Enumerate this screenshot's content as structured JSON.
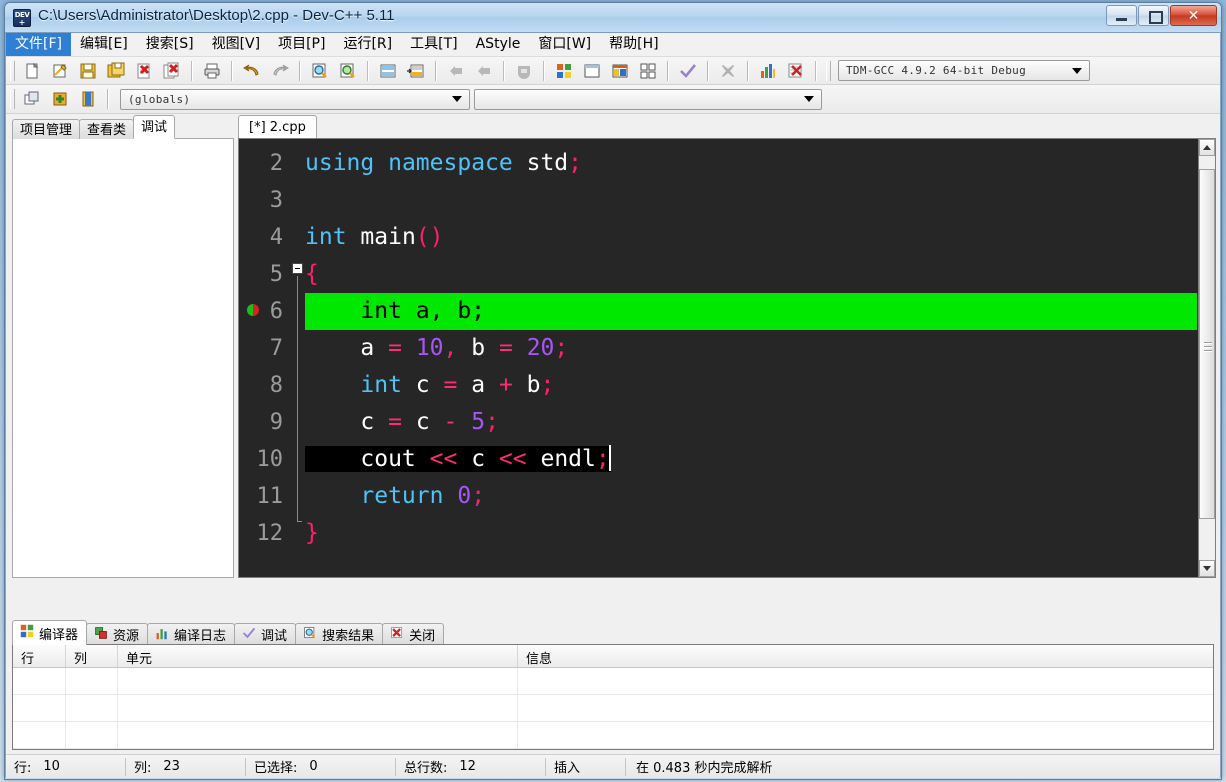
{
  "window": {
    "title": "C:\\Users\\Administrator\\Desktop\\2.cpp - Dev-C++ 5.11",
    "icon": "devcpp-icon",
    "minimize": "minimize-button",
    "maximize": "maximize-button",
    "close": "close-button"
  },
  "menu": [
    {
      "label": "文件[F]",
      "active": true
    },
    {
      "label": "编辑[E]",
      "active": false
    },
    {
      "label": "搜索[S]",
      "active": false
    },
    {
      "label": "视图[V]",
      "active": false
    },
    {
      "label": "项目[P]",
      "active": false
    },
    {
      "label": "运行[R]",
      "active": false
    },
    {
      "label": "工具[T]",
      "active": false
    },
    {
      "label": "AStyle",
      "active": false
    },
    {
      "label": "窗口[W]",
      "active": false
    },
    {
      "label": "帮助[H]",
      "active": false
    }
  ],
  "toolbar1": {
    "buttons": [
      "new-file-icon",
      "open-file-icon",
      "save-icon",
      "save-all-icon",
      "close-file-icon",
      "close-all-icon",
      "print-icon",
      "undo-icon",
      "redo-icon",
      "find-icon",
      "find-replace-icon",
      "goto-line-icon",
      "goto-function-icon",
      "back-icon",
      "forward-icon",
      "toggle-icon",
      "compile-icon",
      "run-icon",
      "compile-run-icon",
      "rebuild-all-icon",
      "syntax-check-icon",
      "stop-icon",
      "profile-icon",
      "delete-profile-icon"
    ],
    "compiler_select": "TDM-GCC 4.9.2 64-bit Debug"
  },
  "toolbar2": {
    "buttons": [
      "insert-icon",
      "add-to-project-icon",
      "new-class-icon"
    ],
    "scope_select": "(globals)",
    "member_select": ""
  },
  "left_panel": {
    "tabs": [
      {
        "label": "项目管理",
        "selected": false
      },
      {
        "label": "查看类",
        "selected": false
      },
      {
        "label": "调试",
        "selected": true
      }
    ]
  },
  "editor": {
    "tabs": [
      {
        "label": "[*] 2.cpp",
        "selected": true
      }
    ],
    "first_visible_line": 2,
    "lines": [
      {
        "number": "2",
        "highlight": "none",
        "tokens": [
          {
            "text": "using",
            "cls": "t-key"
          },
          {
            "text": " ",
            "cls": "t-id"
          },
          {
            "text": "namespace",
            "cls": "t-key"
          },
          {
            "text": " ",
            "cls": "t-id"
          },
          {
            "text": "std",
            "cls": "t-id"
          },
          {
            "text": ";",
            "cls": "t-punct"
          }
        ]
      },
      {
        "number": "3",
        "highlight": "none",
        "tokens": []
      },
      {
        "number": "4",
        "highlight": "none",
        "tokens": [
          {
            "text": "int",
            "cls": "t-key"
          },
          {
            "text": " ",
            "cls": "t-id"
          },
          {
            "text": "main",
            "cls": "t-id"
          },
          {
            "text": "()",
            "cls": "t-punct"
          }
        ]
      },
      {
        "number": "5",
        "highlight": "none",
        "tokens": [
          {
            "text": "{",
            "cls": "t-brace"
          }
        ]
      },
      {
        "number": "6",
        "highlight": "green",
        "breakpoint": true,
        "tokens": [
          {
            "text": "    int a, b;",
            "cls": "t-id"
          }
        ]
      },
      {
        "number": "7",
        "highlight": "none",
        "tokens": [
          {
            "text": "    ",
            "cls": "t-id"
          },
          {
            "text": "a",
            "cls": "t-id"
          },
          {
            "text": " ",
            "cls": "t-id"
          },
          {
            "text": "=",
            "cls": "t-op"
          },
          {
            "text": " ",
            "cls": "t-id"
          },
          {
            "text": "10",
            "cls": "t-num"
          },
          {
            "text": ",",
            "cls": "t-punct"
          },
          {
            "text": " ",
            "cls": "t-id"
          },
          {
            "text": "b",
            "cls": "t-id"
          },
          {
            "text": " ",
            "cls": "t-id"
          },
          {
            "text": "=",
            "cls": "t-op"
          },
          {
            "text": " ",
            "cls": "t-id"
          },
          {
            "text": "20",
            "cls": "t-num"
          },
          {
            "text": ";",
            "cls": "t-punct"
          }
        ]
      },
      {
        "number": "8",
        "highlight": "none",
        "tokens": [
          {
            "text": "    ",
            "cls": "t-id"
          },
          {
            "text": "int",
            "cls": "t-key"
          },
          {
            "text": " ",
            "cls": "t-id"
          },
          {
            "text": "c",
            "cls": "t-id"
          },
          {
            "text": " ",
            "cls": "t-id"
          },
          {
            "text": "=",
            "cls": "t-op"
          },
          {
            "text": " ",
            "cls": "t-id"
          },
          {
            "text": "a",
            "cls": "t-id"
          },
          {
            "text": " ",
            "cls": "t-id"
          },
          {
            "text": "+",
            "cls": "t-op"
          },
          {
            "text": " ",
            "cls": "t-id"
          },
          {
            "text": "b",
            "cls": "t-id"
          },
          {
            "text": ";",
            "cls": "t-punct"
          }
        ]
      },
      {
        "number": "9",
        "highlight": "none",
        "tokens": [
          {
            "text": "    ",
            "cls": "t-id"
          },
          {
            "text": "c",
            "cls": "t-id"
          },
          {
            "text": " ",
            "cls": "t-id"
          },
          {
            "text": "=",
            "cls": "t-op"
          },
          {
            "text": " ",
            "cls": "t-id"
          },
          {
            "text": "c",
            "cls": "t-id"
          },
          {
            "text": " ",
            "cls": "t-id"
          },
          {
            "text": "-",
            "cls": "t-op"
          },
          {
            "text": " ",
            "cls": "t-id"
          },
          {
            "text": "5",
            "cls": "t-num"
          },
          {
            "text": ";",
            "cls": "t-punct"
          }
        ]
      },
      {
        "number": "10",
        "highlight": "black",
        "caret": true,
        "tokens": [
          {
            "text": "    ",
            "cls": "t-id"
          },
          {
            "text": "cout",
            "cls": "t-id"
          },
          {
            "text": " ",
            "cls": "t-id"
          },
          {
            "text": "<<",
            "cls": "t-op"
          },
          {
            "text": " ",
            "cls": "t-id"
          },
          {
            "text": "c",
            "cls": "t-id"
          },
          {
            "text": " ",
            "cls": "t-id"
          },
          {
            "text": "<<",
            "cls": "t-op"
          },
          {
            "text": " ",
            "cls": "t-id"
          },
          {
            "text": "endl",
            "cls": "t-id"
          },
          {
            "text": ";",
            "cls": "t-punct"
          }
        ]
      },
      {
        "number": "11",
        "highlight": "none",
        "tokens": [
          {
            "text": "    ",
            "cls": "t-id"
          },
          {
            "text": "return",
            "cls": "t-key"
          },
          {
            "text": " ",
            "cls": "t-id"
          },
          {
            "text": "0",
            "cls": "t-num"
          },
          {
            "text": ";",
            "cls": "t-punct"
          }
        ]
      },
      {
        "number": "12",
        "highlight": "none",
        "tokens": [
          {
            "text": "}",
            "cls": "t-brace"
          }
        ]
      }
    ],
    "scrollbar": {
      "up": "scroll-up-arrow",
      "down": "scroll-down-arrow"
    }
  },
  "bottom_panel": {
    "tabs": [
      {
        "label": "编译器",
        "icon": "compiler-icon",
        "selected": true
      },
      {
        "label": "资源",
        "icon": "resource-icon",
        "selected": false
      },
      {
        "label": "编译日志",
        "icon": "log-icon",
        "selected": false
      },
      {
        "label": "调试",
        "icon": "debug-check-icon",
        "selected": false
      },
      {
        "label": "搜索结果",
        "icon": "search-results-icon",
        "selected": false
      },
      {
        "label": "关闭",
        "icon": "close-panel-icon",
        "selected": false
      }
    ],
    "columns": [
      "行",
      "列",
      "单元",
      "信息"
    ],
    "rows": []
  },
  "statusbar": {
    "row_label": "行:",
    "row_value": "10",
    "col_label": "列:",
    "col_value": "23",
    "sel_label": "已选择:",
    "sel_value": "0",
    "total_label": "总行数:",
    "total_value": "12",
    "mode": "插入",
    "message": "在 0.483 秒内完成解析"
  },
  "colors": {
    "accent": "#2f7fd4",
    "editor_bg": "#262626",
    "active_line": "#00e800",
    "current_line": "#000000",
    "keyword": "#4fc3f7",
    "number": "#a855f7",
    "punct": "#ff1f6b",
    "close_button": "#c33a22"
  }
}
